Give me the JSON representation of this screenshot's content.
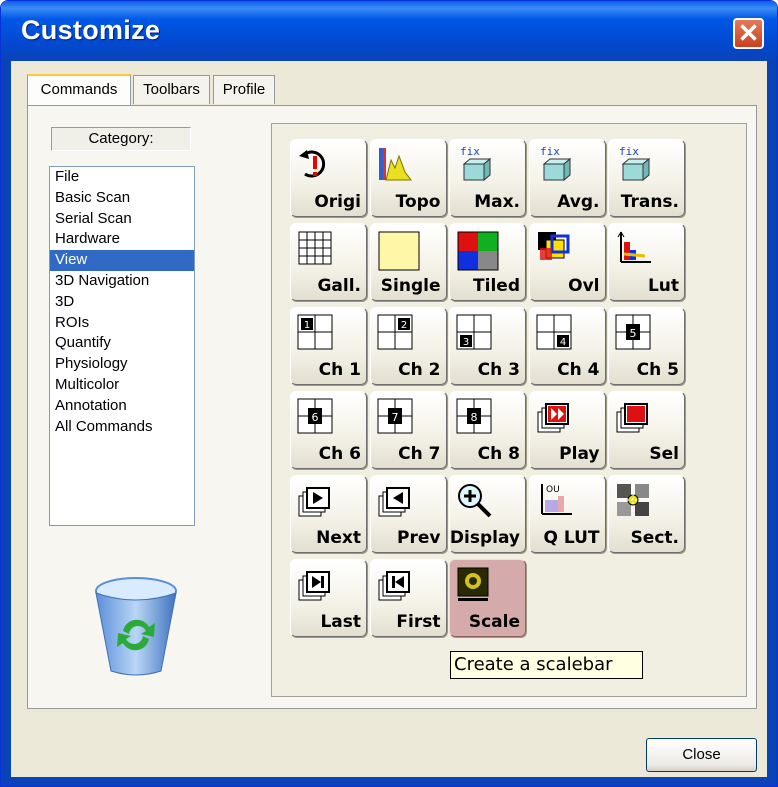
{
  "window": {
    "title": "Customize"
  },
  "tabs": [
    {
      "label": "Commands",
      "active": true
    },
    {
      "label": "Toolbars",
      "active": false
    },
    {
      "label": "Profile",
      "active": false
    }
  ],
  "category": {
    "label": "Category:",
    "items": [
      "File",
      "Basic Scan",
      "Serial Scan",
      "Hardware",
      "View",
      "3D Navigation",
      "3D",
      "ROIs",
      "Quantify",
      "Physiology",
      "Multicolor",
      "Annotation",
      "All Commands"
    ],
    "selected": "View"
  },
  "commands": [
    {
      "label": "Origi",
      "icon": "original-icon"
    },
    {
      "label": "Topo",
      "icon": "topo-icon"
    },
    {
      "label": "Max.",
      "icon": "max-fix-icon",
      "icon_text": "fix"
    },
    {
      "label": "Avg.",
      "icon": "avg-fix-icon",
      "icon_text": "fix"
    },
    {
      "label": "Trans.",
      "icon": "trans-fix-icon",
      "icon_text": "fix"
    },
    {
      "label": "Gall.",
      "icon": "gallery-icon"
    },
    {
      "label": "Single",
      "icon": "single-icon"
    },
    {
      "label": "Tiled",
      "icon": "tiled-icon"
    },
    {
      "label": "Ovl",
      "icon": "overlay-icon"
    },
    {
      "label": "Lut",
      "icon": "lut-icon"
    },
    {
      "label": "Ch 1",
      "icon": "channel-1-icon"
    },
    {
      "label": "Ch 2",
      "icon": "channel-2-icon"
    },
    {
      "label": "Ch 3",
      "icon": "channel-3-icon"
    },
    {
      "label": "Ch 4",
      "icon": "channel-4-icon"
    },
    {
      "label": "Ch 5",
      "icon": "channel-5-icon",
      "icon_text": "5"
    },
    {
      "label": "Ch 6",
      "icon": "channel-6-icon",
      "icon_text": "6"
    },
    {
      "label": "Ch 7",
      "icon": "channel-7-icon",
      "icon_text": "7"
    },
    {
      "label": "Ch 8",
      "icon": "channel-8-icon",
      "icon_text": "8"
    },
    {
      "label": "Play",
      "icon": "play-icon"
    },
    {
      "label": "Sel",
      "icon": "select-icon"
    },
    {
      "label": "Next",
      "icon": "next-icon"
    },
    {
      "label": "Prev",
      "icon": "prev-icon"
    },
    {
      "label": "Display",
      "icon": "zoom-display-icon"
    },
    {
      "label": "Q LUT",
      "icon": "quant-lut-icon",
      "icon_text": "OU"
    },
    {
      "label": "Sect.",
      "icon": "section-icon"
    },
    {
      "label": "Last",
      "icon": "last-icon"
    },
    {
      "label": "First",
      "icon": "first-icon"
    },
    {
      "label": "Scale",
      "icon": "scalebar-icon",
      "active": true
    }
  ],
  "tooltip": {
    "text": "Create a scalebar"
  },
  "buttons": {
    "close": "Close"
  },
  "colors": {
    "title_bar": "#0A43B7",
    "selection": "#316AC5",
    "active_command": "#D4AAAA",
    "tooltip_bg": "#FFFFE1",
    "close_red": "#C9401E"
  }
}
